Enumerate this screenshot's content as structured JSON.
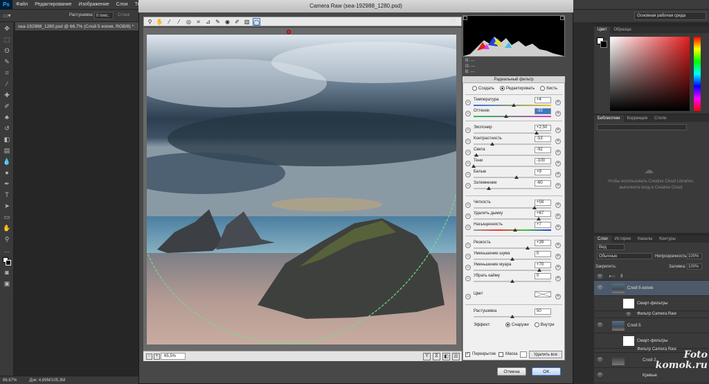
{
  "menubar": {
    "logo": "Ps",
    "items": [
      "Файл",
      "Редактирование",
      "Изображение",
      "Слои",
      "Текст"
    ]
  },
  "optbar": {
    "feather_label": "Растушевка:",
    "feather_value": "0 пикс.",
    "antialias": "Сглаж"
  },
  "doc_tab": "sea-192988_1280.psd @ 66,7% (Слой 5 копия, RGB/8) *",
  "status": {
    "zoom": "66,67%",
    "doc": "Док: 4,69M/105,3M"
  },
  "workspace": "Основная рабочая среда",
  "color_panel": {
    "tabs": [
      "Цвет",
      "Образцы"
    ]
  },
  "libraries_panel": {
    "tabs": [
      "Библиотеки",
      "Коррекция",
      "Стили"
    ],
    "message": "Чтобы использовать Creative Cloud Libraries, выполните вход в Creative Cloud"
  },
  "layers_panel": {
    "tabs": [
      "Слои",
      "Истории",
      "Каналы",
      "Контуры"
    ],
    "kind": "Вид",
    "blend": "Обычные",
    "opacity_label": "Непрозрачность:",
    "opacity": "100%",
    "lock_label": "Закрепить:",
    "fill_label": "Заливка:",
    "fill": "100%",
    "group_name": "3",
    "layers": [
      {
        "name": "Слой 5 копия"
      },
      {
        "name": "Смарт-фильтры"
      },
      {
        "name": "Фильтр Camera Raw"
      },
      {
        "name": "Слой 5"
      },
      {
        "name": "Смарт-фильтры"
      },
      {
        "name": "Фильтр Camera Raw"
      },
      {
        "name": "Слой 2"
      },
      {
        "name": "Кривые"
      }
    ]
  },
  "camera_raw": {
    "title": "Camera Raw (sea-192988_1280.psd)",
    "zoom": "65,5%",
    "rgb": {
      "r": "R:  ---",
      "g": "G:  ---",
      "b": "B:  ---"
    },
    "panel_title": "Радиальный фильтр",
    "modes": [
      "Создать",
      "Редактировать",
      "Кисть"
    ],
    "sliders": [
      {
        "label": "Температура",
        "value": "+4",
        "pos": 0.52
      },
      {
        "label": "Оттенок",
        "value": "-33",
        "pos": 0.42,
        "selected": true
      },
      {
        "label": "Экспонир",
        "value": "+2,50",
        "pos": 0.81
      },
      {
        "label": "Контрастность",
        "value": "-53",
        "pos": 0.24
      },
      {
        "label": "Света",
        "value": "-92",
        "pos": 0.04
      },
      {
        "label": "Тени",
        "value": "-100",
        "pos": 0.0
      },
      {
        "label": "Белые",
        "value": "+9",
        "pos": 0.55
      },
      {
        "label": "Затемнение",
        "value": "-60",
        "pos": 0.2
      },
      {
        "label": "Четкость",
        "value": "+58",
        "pos": 0.79
      },
      {
        "label": "Удалить дымку",
        "value": "+67",
        "pos": 0.84
      },
      {
        "label": "Насыщенность",
        "value": "+7",
        "pos": 0.54
      },
      {
        "label": "Резкость",
        "value": "+39",
        "pos": 0.7
      },
      {
        "label": "Уменьшение шума",
        "value": "0",
        "pos": 0.5
      },
      {
        "label": "Уменьшение муара",
        "value": "+70",
        "pos": 0.85
      },
      {
        "label": "Убрать кайму",
        "value": "0",
        "pos": 0.5
      }
    ],
    "color_label": "Цвет",
    "feather_label": "Растушевка",
    "feather_value": "50",
    "feather_pos": 0.5,
    "effect_label": "Эффект:",
    "effect_options": [
      "Снаружи",
      "Внутри"
    ],
    "overlay_label": "Перекрытие",
    "mask_label": "Маска",
    "delete_all": "Удалить все",
    "cancel": "Отмена",
    "ok": "OK"
  },
  "watermark": {
    "line1": "Foto",
    "line2": "komok.ru"
  }
}
